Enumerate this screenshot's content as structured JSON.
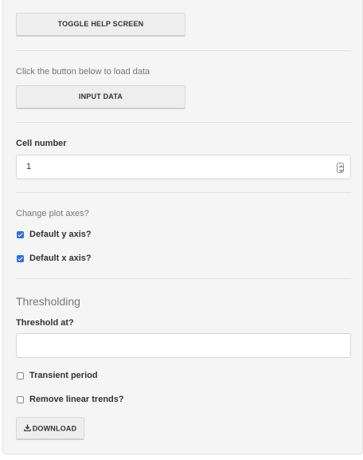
{
  "help_button_label": "TOGGLE HELP SCREEN",
  "load_hint": "Click the button below to load data",
  "input_button_label": "INPUT DATA",
  "cell_number": {
    "label": "Cell number",
    "value": "1"
  },
  "axes": {
    "prompt": "Change plot axes?",
    "default_y": {
      "label": "Default y axis?",
      "checked": true
    },
    "default_x": {
      "label": "Default x axis?",
      "checked": true
    }
  },
  "thresholding": {
    "heading": "Thresholding",
    "threshold_label": "Threshold at?",
    "threshold_value": "",
    "transient_period": {
      "label": "Transient period",
      "checked": false
    },
    "remove_linear_trends": {
      "label": "Remove linear trends?",
      "checked": false
    }
  },
  "download_button_label": "DOWNLOAD",
  "colors": {
    "panel_bg": "#f5f5f5",
    "button_bg": "#eeeeee",
    "checkbox_accent": "#2f6fdf"
  },
  "icons": {
    "download": "download-icon",
    "stepper": "number-stepper-icon"
  }
}
